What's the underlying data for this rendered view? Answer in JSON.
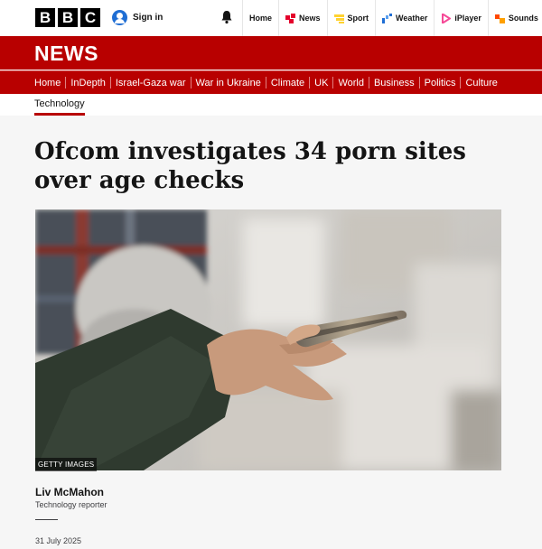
{
  "logo": {
    "letters": [
      "B",
      "B",
      "C"
    ]
  },
  "account": {
    "signin_label": "Sign in"
  },
  "topnav": [
    {
      "label": "Home",
      "icon": "home-icon",
      "color": ""
    },
    {
      "label": "News",
      "icon": "news-icon",
      "color": "#e4002b"
    },
    {
      "label": "Sport",
      "icon": "sport-icon",
      "color": "#ffd230"
    },
    {
      "label": "Weather",
      "icon": "weather-icon",
      "color": "#1f6ed4"
    },
    {
      "label": "iPlayer",
      "icon": "iplayer-icon",
      "color": "#f54997"
    },
    {
      "label": "Sounds",
      "icon": "sounds-icon",
      "color": "#ff4800"
    }
  ],
  "banner": {
    "title": "NEWS",
    "color": "#b80000"
  },
  "nav": {
    "items": [
      "Home",
      "InDepth",
      "Israel-Gaza war",
      "War in Ukraine",
      "Climate",
      "UK",
      "World",
      "Business",
      "Politics",
      "Culture"
    ]
  },
  "section": {
    "active_tab": "Technology"
  },
  "article": {
    "headline": "Ofcom investigates 34 porn sites over age checks",
    "image_credit": "GETTY IMAGES",
    "author": "Liv McMahon",
    "author_role": "Technology reporter",
    "date": "31 July 2025"
  }
}
